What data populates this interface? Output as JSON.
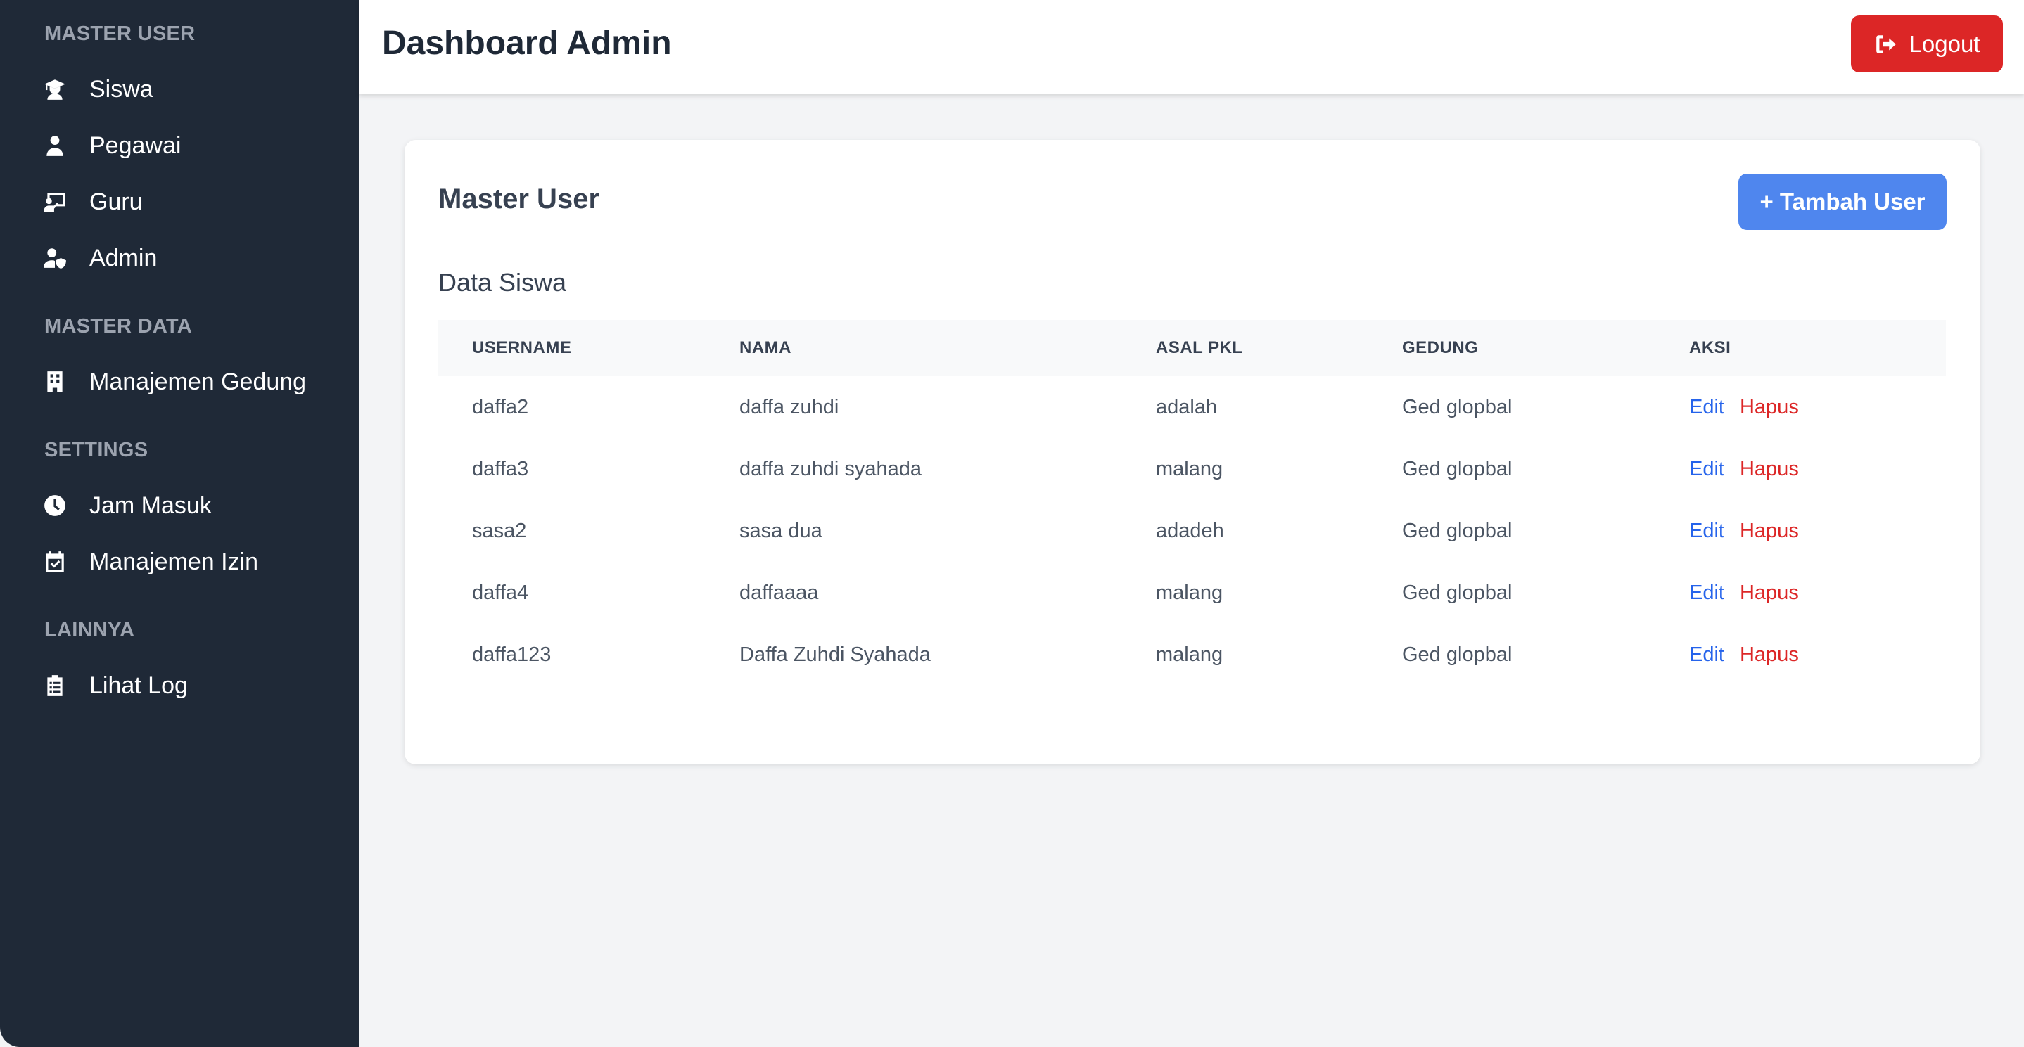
{
  "sidebar": {
    "sections": [
      {
        "title": "MASTER USER",
        "items": [
          {
            "label": "Siswa",
            "icon": "student-icon"
          },
          {
            "label": "Pegawai",
            "icon": "user-icon"
          },
          {
            "label": "Guru",
            "icon": "teacher-icon"
          },
          {
            "label": "Admin",
            "icon": "user-shield-icon"
          }
        ]
      },
      {
        "title": "MASTER DATA",
        "items": [
          {
            "label": "Manajemen Gedung",
            "icon": "building-icon"
          }
        ]
      },
      {
        "title": "SETTINGS",
        "items": [
          {
            "label": "Jam Masuk",
            "icon": "clock-icon"
          },
          {
            "label": "Manajemen Izin",
            "icon": "calendar-check-icon"
          }
        ]
      },
      {
        "title": "LAINNYA",
        "items": [
          {
            "label": "Lihat Log",
            "icon": "clipboard-list-icon"
          }
        ]
      }
    ]
  },
  "header": {
    "title": "Dashboard Admin",
    "logout_label": "Logout"
  },
  "main": {
    "card_title": "Master User",
    "add_button_label": "+ Tambah User",
    "section_title": "Data Siswa",
    "table": {
      "headers": [
        "USERNAME",
        "NAMA",
        "ASAL PKL",
        "GEDUNG",
        "AKSI"
      ],
      "rows": [
        {
          "username": "daffa2",
          "nama": "daffa zuhdi",
          "asal": "adalah",
          "gedung": "Ged glopbal"
        },
        {
          "username": "daffa3",
          "nama": "daffa zuhdi syahada",
          "asal": "malang",
          "gedung": "Ged glopbal"
        },
        {
          "username": "sasa2",
          "nama": "sasa dua",
          "asal": "adadeh",
          "gedung": "Ged glopbal"
        },
        {
          "username": "daffa4",
          "nama": "daffaaaa",
          "asal": "malang",
          "gedung": "Ged glopbal"
        },
        {
          "username": "daffa123",
          "nama": "Daffa Zuhdi Syahada",
          "asal": "malang",
          "gedung": "Ged glopbal"
        }
      ],
      "edit_label": "Edit",
      "delete_label": "Hapus"
    }
  },
  "colors": {
    "sidebar_bg": "#1f2937",
    "logout": "#dc2626",
    "primary": "#4f86ee",
    "edit_link": "#2563eb",
    "delete_link": "#dc2626"
  }
}
